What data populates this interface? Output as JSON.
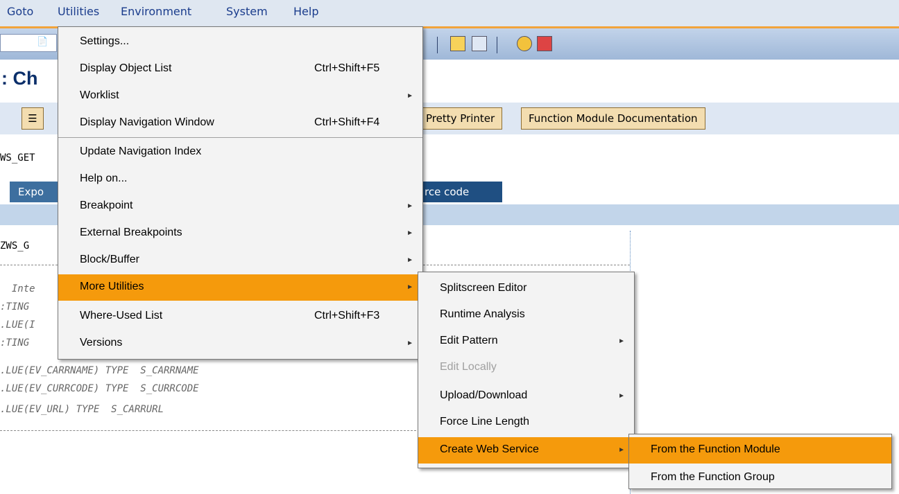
{
  "menubar": {
    "items": [
      "Goto",
      "Utilities",
      "Environment",
      "System",
      "Help"
    ]
  },
  "page_title": ": Ch",
  "app_toolbar": {
    "pretty_printer": "Pretty Printer",
    "fm_documentation": "Function Module Documentation"
  },
  "fm_name": "WS_GET",
  "tabs": {
    "export": "Expo",
    "source_code": "rce code"
  },
  "code": {
    "lines": [
      "ZWS_G",
      "  Inte",
      ":TING",
      ".LUE(I",
      ":TING",
      ".LUE(EV_CARRNAME) TYPE  S_CARRNAME",
      ".LUE(EV_CURRCODE) TYPE  S_CURRCODE",
      ".LUE(EV_URL) TYPE  S_CARRURL"
    ]
  },
  "utilities_menu": {
    "items": [
      {
        "label": "Settings...",
        "shortcut": ""
      },
      {
        "label": "Display Object List",
        "shortcut": "Ctrl+Shift+F5"
      },
      {
        "label": "Worklist",
        "shortcut": ""
      },
      {
        "label": "Display Navigation Window",
        "shortcut": "Ctrl+Shift+F4"
      },
      {
        "label": "Update Navigation Index",
        "shortcut": ""
      },
      {
        "label": "Help on...",
        "shortcut": ""
      },
      {
        "label": "Breakpoint",
        "shortcut": ""
      },
      {
        "label": "External Breakpoints",
        "shortcut": ""
      },
      {
        "label": "Block/Buffer",
        "shortcut": ""
      },
      {
        "label": "More Utilities",
        "shortcut": ""
      },
      {
        "label": "Where-Used List",
        "shortcut": "Ctrl+Shift+F3"
      },
      {
        "label": "Versions",
        "shortcut": ""
      }
    ]
  },
  "more_utilities_menu": {
    "items": [
      {
        "label": "Splitscreen Editor"
      },
      {
        "label": "Runtime Analysis"
      },
      {
        "label": "Edit Pattern"
      },
      {
        "label": "Edit Locally"
      },
      {
        "label": "Upload/Download"
      },
      {
        "label": "Force Line Length"
      },
      {
        "label": "Create Web Service"
      }
    ]
  },
  "create_ws_menu": {
    "items": [
      {
        "label": "From the Function Module"
      },
      {
        "label": "From the Function Group"
      }
    ]
  },
  "colors": {
    "highlight": "#f59a0c",
    "tab_blue": "#3d6f9f",
    "title_blue": "#0b2f6a"
  }
}
